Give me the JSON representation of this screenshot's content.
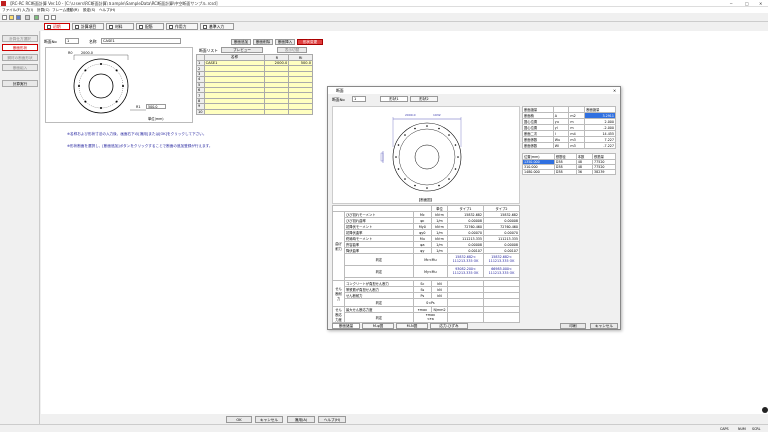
{
  "app": {
    "title": "【RC-RC RC断面計算 Ver.10 - [C:\\Ｕsers\\RC断面計算\\Ｓample\\SampleData\\RC断面計算\\中空断面サンプル.rcsd]",
    "min": "─",
    "max": "□",
    "close": "✕"
  },
  "menu": [
    "ファイル(F)",
    "入力(I)",
    "計算(C)",
    "フレーム連動(R)",
    "設定(S)",
    "ヘルプ(H)"
  ],
  "tabs": [
    {
      "label": "初期",
      "active": true
    },
    {
      "label": "計算項目",
      "active": false
    },
    {
      "label": "材料",
      "active": false
    },
    {
      "label": "配筋",
      "active": false
    },
    {
      "label": "作用力",
      "active": false
    },
    {
      "label": "基準入力",
      "active": false
    }
  ],
  "sidebar": [
    {
      "label": "計算仕方選択",
      "state": "disabled"
    },
    {
      "label": "断面形状",
      "state": "active"
    },
    {
      "label": "鋼材の断面形状",
      "state": "disabled"
    },
    {
      "label": "断面組入",
      "state": "disabled"
    },
    {
      "label": "計算実行",
      "state": "normal"
    }
  ],
  "main": {
    "section_no_label": "断面No",
    "section_no": "1",
    "name_label": "名称",
    "name_value": "CASE1",
    "dim_label_r0": "R0",
    "dim_r0": "2000.0",
    "dim_label_r1": "R1",
    "dim_r1": "500.0",
    "unit_note": "単位(mm)",
    "action_buttons": [
      "断面追加",
      "断面削除",
      "断面挿入",
      "形状変更"
    ],
    "list_header": "断面リスト",
    "preview_btn": "プレビュー",
    "list_btn": "表示切替",
    "table_cols": [
      "",
      "名称",
      "R",
      "Ri"
    ],
    "table_rows": [
      [
        "1",
        "CASE1",
        "2000.0",
        "500.0"
      ],
      [
        "2",
        "",
        "",
        ""
      ],
      [
        "3",
        "",
        "",
        ""
      ],
      [
        "4",
        "",
        "",
        ""
      ],
      [
        "5",
        "",
        "",
        ""
      ],
      [
        "6",
        "",
        "",
        ""
      ],
      [
        "7",
        "",
        "",
        ""
      ],
      [
        "8",
        "",
        "",
        ""
      ],
      [
        "9",
        "",
        "",
        ""
      ],
      [
        "10",
        "",
        "",
        ""
      ]
    ],
    "note1": "※名称および形状寸法の入力後、画面右下の[適用]または[OK]をクリックして下さい。",
    "note2": "※形状断面を選択し、[断面追加]ボタンをクリックすることで断面の追加登録が行えます。"
  },
  "dialog": {
    "title": "断面",
    "close": "✕",
    "section_no_label": "断面No",
    "section_no": "1",
    "tabs": [
      "形状1",
      "形状2"
    ],
    "drawing_dim_top": "2000.0",
    "drawing_dim_top2": "1932",
    "drawing_caption": "【断面図】",
    "props_header": [
      "断面諸量",
      "",
      "断面諸量"
    ],
    "props": [
      [
        "断面積",
        "A",
        "m2",
        "3.2911"
      ],
      [
        "図心位置",
        "yu",
        "m",
        "2.000"
      ],
      [
        "図心位置",
        "yl",
        "m",
        "-2.000"
      ],
      [
        "断面二次",
        "I",
        "m4",
        "14.455"
      ],
      [
        "断面係数",
        "Wu",
        "m3",
        "7.227"
      ],
      [
        "断面係数",
        "Wl",
        "m3",
        "-7.227"
      ]
    ],
    "rebar_header": [
      "位置(mm)",
      "鉄筋径",
      "本数",
      "鉄筋量"
    ],
    "rebar": [
      [
        "1350.000",
        "D38",
        "48",
        "77520"
      ],
      [
        "310.000",
        "D38",
        "48",
        "77520"
      ],
      [
        "1480.000",
        "D38",
        "36",
        "38239"
      ]
    ],
    "calc_header": [
      "",
      "",
      "",
      "単位",
      "タイプ1",
      "タイプ2"
    ],
    "calc_group1": "曲げ耐力",
    "calc_rows1": [
      [
        "ひび割れモーメント",
        "Mc",
        "kN·m",
        "15832.682",
        "15832.682"
      ],
      [
        "ひび割れ曲率",
        "φc",
        "1/m",
        "0.00008",
        "0.00008"
      ],
      [
        "初降伏モーメント",
        "My0",
        "kN·m",
        "72760.460",
        "72760.460"
      ],
      [
        "初降伏曲率",
        "φy0",
        "1/m",
        "0.00070",
        "0.00070"
      ],
      [
        "終局時モーメント",
        "Mu",
        "kN·m",
        "111213.335",
        "111213.335"
      ],
      [
        "許容曲率",
        "φa",
        "1/m",
        "0.00008",
        "0.00008"
      ],
      [
        "降伏曲率",
        "φy",
        "1/m",
        "0.00107",
        "0.00107"
      ]
    ],
    "judge1_label": "判定",
    "judge1_cond": "Mc<Mu",
    "judge1_a": "15832.682<\n111213.335  OK",
    "judge1_b": "15832.682<\n111213.335  OK",
    "judge2_label": "判定",
    "judge2_cond": "My<Mu",
    "judge2_a": "93082.200<\n111213.335  OK",
    "judge2_b": "66985.000<\n111213.335  OK",
    "calc_group2": "せん断耐力",
    "calc_rows2": [
      [
        "コンクリートが負担せん断力",
        "Sc",
        "kN",
        "",
        ""
      ],
      [
        "帯鉄筋が負担せん断力",
        "Ss",
        "kN",
        "",
        ""
      ],
      [
        "せん断耐力",
        "Ps",
        "kN",
        "",
        ""
      ]
    ],
    "judge3_label": "判定",
    "judge3_cond": "S<Ps",
    "calc_group3": "せん断応力度",
    "calc_rows3": [
      [
        "最大せん断応力度",
        "τmax",
        "N/mm2",
        "",
        ""
      ]
    ],
    "judge4_label": "判定",
    "judge4_cond": "τmax\n<τa",
    "bottom_tabs": [
      "断面諸量",
      "M-φ図",
      "M-N図",
      "応力-ひずみ"
    ],
    "print_btn": "印刷",
    "cancel_btn": "キャンセル"
  },
  "footer": {
    "ok": "OK",
    "cancel": "キャンセル",
    "apply": "適用(A)",
    "help": "ヘルプ(H)",
    "status_caps": "CAPS",
    "status_num": "NUM",
    "status_scrl": "SCRL"
  }
}
